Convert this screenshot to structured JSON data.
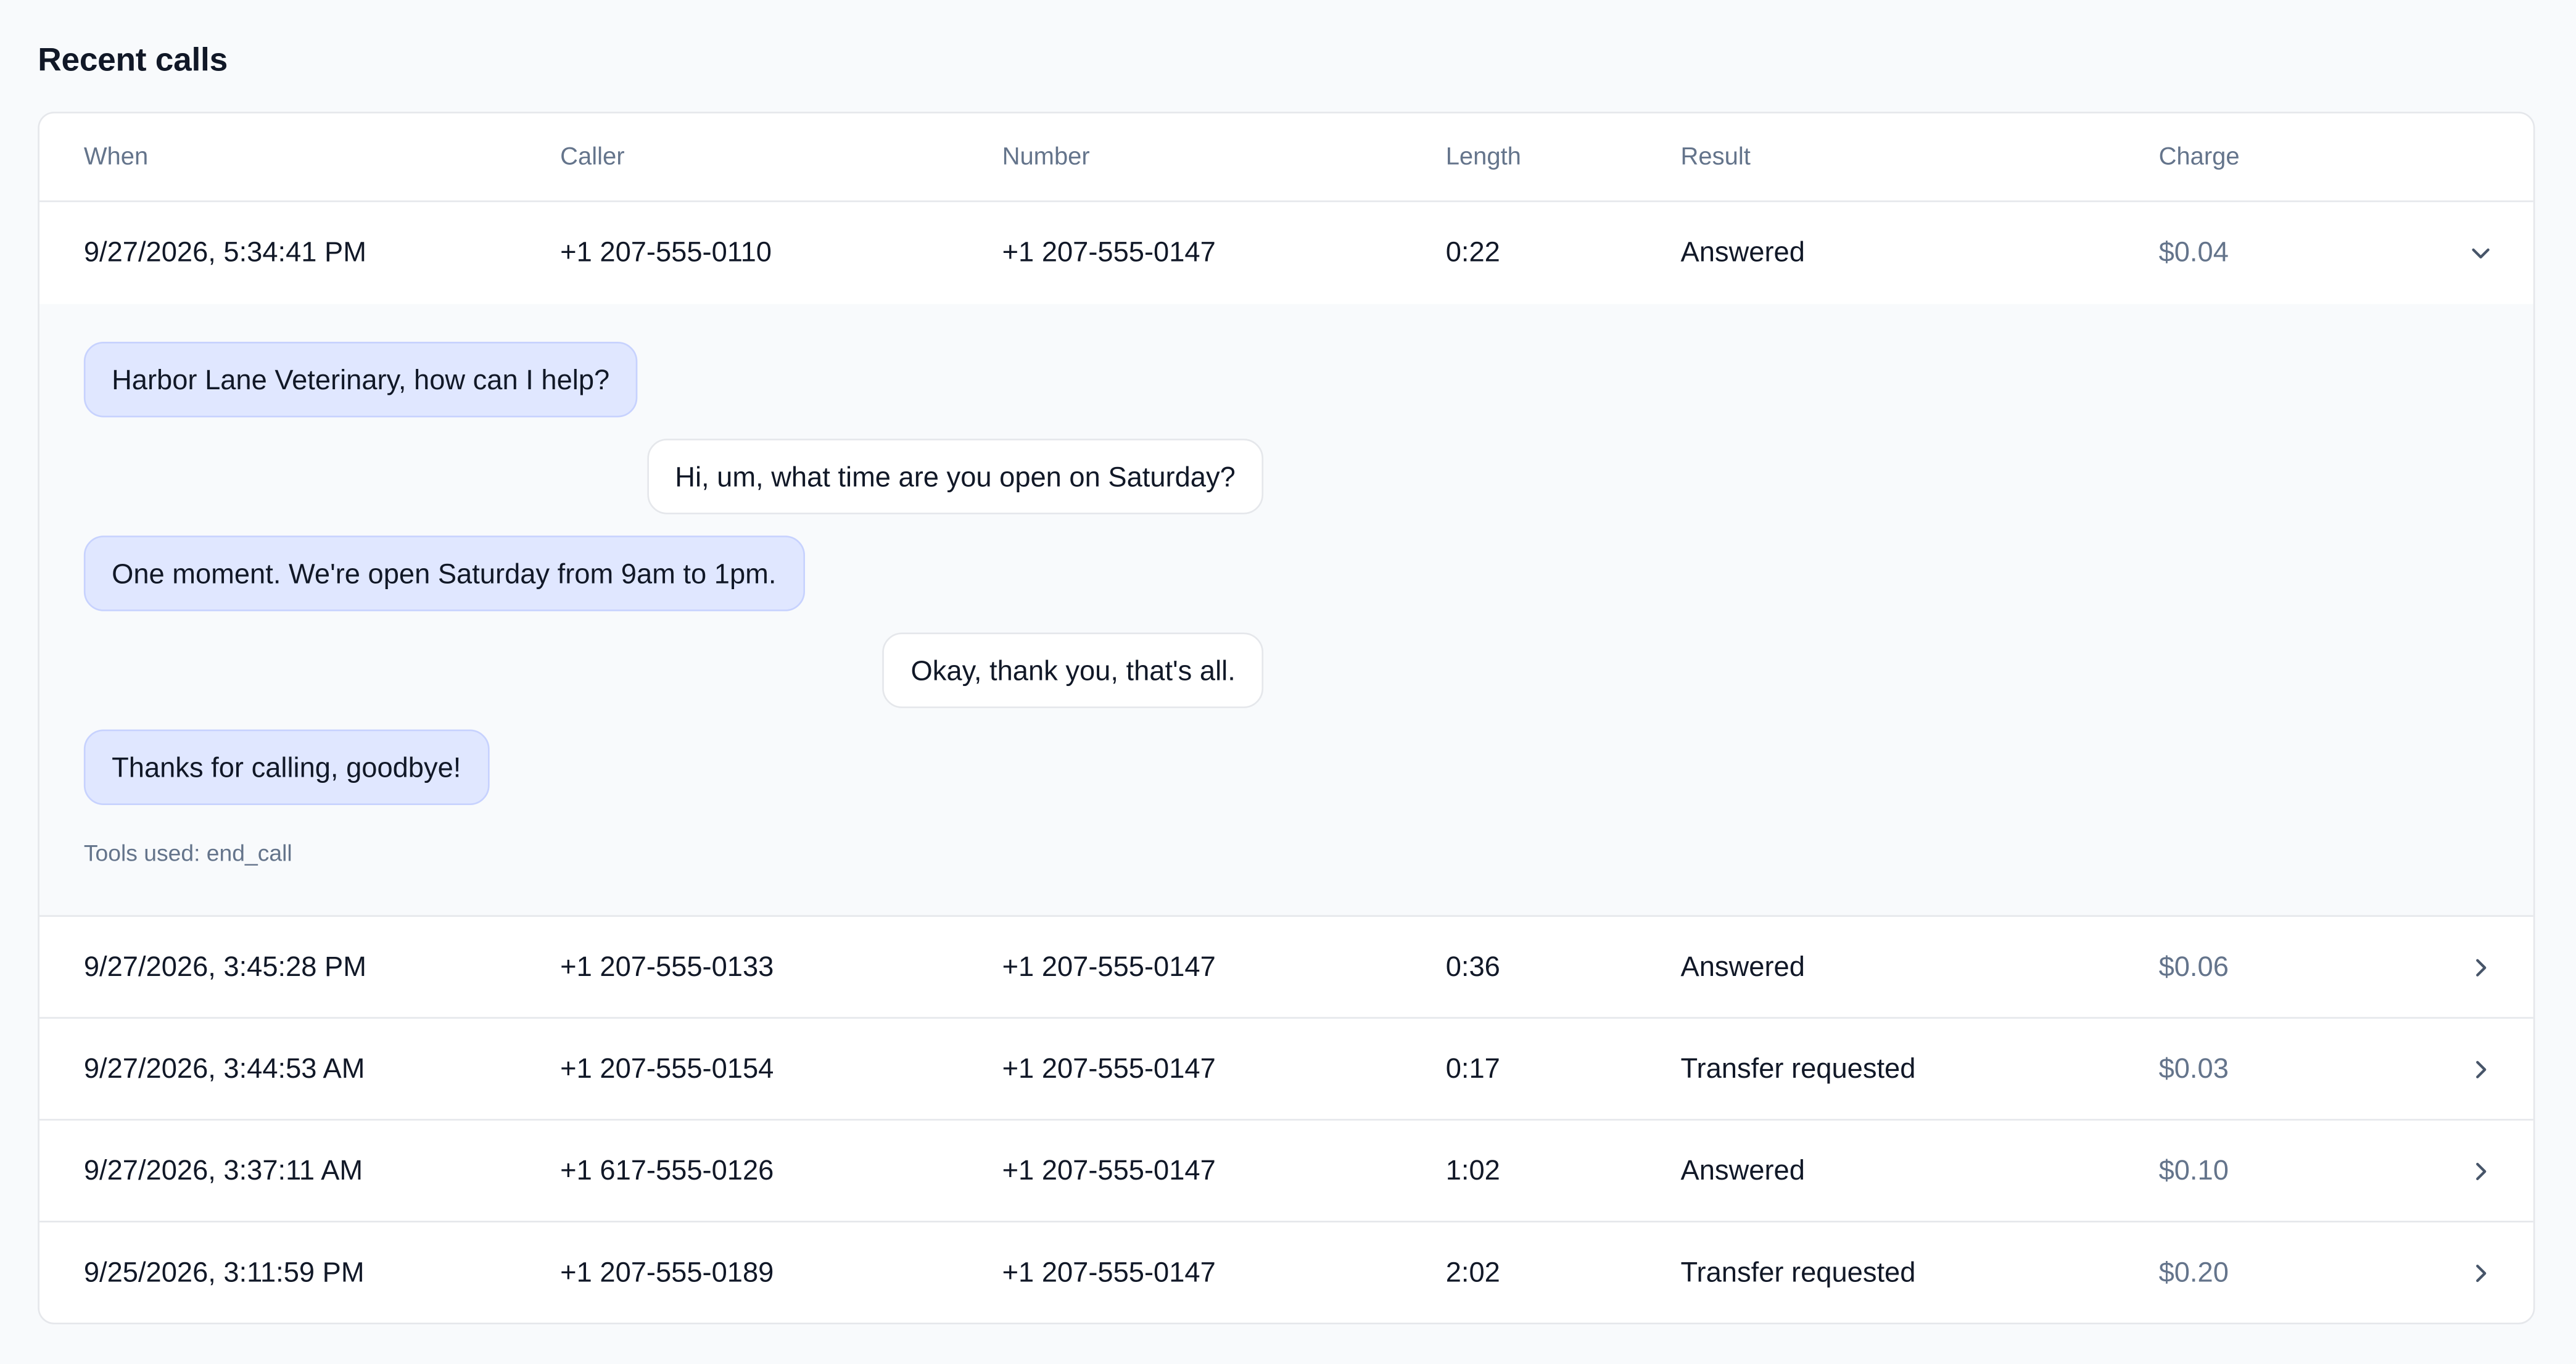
{
  "page": {
    "title": "Recent calls"
  },
  "table": {
    "headers": {
      "when": "When",
      "caller": "Caller",
      "number": "Number",
      "length": "Length",
      "result": "Result",
      "charge": "Charge"
    },
    "rows": [
      {
        "when": "9/27/2026, 5:34:41 PM",
        "caller": "+1 207-555-0110",
        "number": "+1 207-555-0147",
        "length": "0:22",
        "result": "Answered",
        "charge": "$0.04",
        "expanded": true
      },
      {
        "when": "9/27/2026, 3:45:28 PM",
        "caller": "+1 207-555-0133",
        "number": "+1 207-555-0147",
        "length": "0:36",
        "result": "Answered",
        "charge": "$0.06",
        "expanded": false
      },
      {
        "when": "9/27/2026, 3:44:53 AM",
        "caller": "+1 207-555-0154",
        "number": "+1 207-555-0147",
        "length": "0:17",
        "result": "Transfer requested",
        "charge": "$0.03",
        "expanded": false
      },
      {
        "when": "9/27/2026, 3:37:11 AM",
        "caller": "+1 617-555-0126",
        "number": "+1 207-555-0147",
        "length": "1:02",
        "result": "Answered",
        "charge": "$0.10",
        "expanded": false
      },
      {
        "when": "9/25/2026, 3:11:59 PM",
        "caller": "+1 207-555-0189",
        "number": "+1 207-555-0147",
        "length": "2:02",
        "result": "Transfer requested",
        "charge": "$0.20",
        "expanded": false
      }
    ]
  },
  "transcript": {
    "messages": [
      {
        "speaker": "agent",
        "text": "Harbor Lane Veterinary, how can I help?"
      },
      {
        "speaker": "caller",
        "text": "Hi, um, what time are you open on Saturday?"
      },
      {
        "speaker": "agent",
        "text": "One moment. We're open Saturday from 9am to 1pm."
      },
      {
        "speaker": "caller",
        "text": "Okay, thank you, that's all."
      },
      {
        "speaker": "agent",
        "text": "Thanks for calling, goodbye!"
      }
    ],
    "tools_used": "Tools used: end_call"
  },
  "icons": {
    "expanded": "chevron-down-icon",
    "collapsed": "chevron-right-icon"
  },
  "colors": {
    "agent_bubble": "#e0e7ff",
    "caller_bubble": "#ffffff",
    "muted_text": "#64748b"
  }
}
